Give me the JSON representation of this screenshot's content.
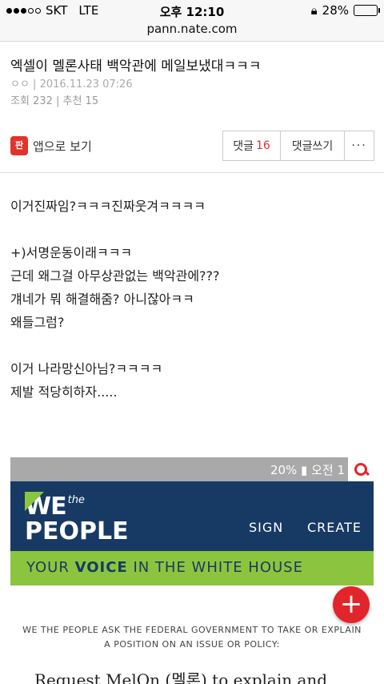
{
  "status_bar": {
    "carrier": "SKT",
    "network": "LTE",
    "time": "오후 12:10",
    "battery": "28%",
    "battery_level": 0.28
  },
  "url": "pann.nate.com",
  "article": {
    "title": "엑셀이 멜론사태 백악관에 메일보냈대ㅋㅋㅋ",
    "author_date": "ㅇㅇ  | 2016.11.23 07:26",
    "stats": "조회 232 | 추천 15"
  },
  "app_bar": {
    "app_icon_text": "판",
    "app_label": "앱으로 보기",
    "comments_label": "댓글",
    "comments_count": "16",
    "write_comment_label": "댓글쓰기",
    "more_label": "···"
  },
  "body_lines": [
    "이거진짜임?ㅋㅋㅋ진짜웃겨ㅋㅋㅋㅋ",
    "",
    "+)서명운동이래ㅋㅋㅋ",
    "근데 왜그걸 아무상관없는 백악관에???",
    "걔네가 뭐 해결해줌? 아니잖아ㅋㅋ",
    "왜들그럼?",
    "",
    "이거 나라망신아님?ㅋㅋㅋㅋ",
    "제발 적당히하자....."
  ],
  "embed": {
    "status_text": "20% ▮ 오전 1",
    "logo_we": "WE",
    "logo_the": "the",
    "logo_people": "PEOPLE",
    "nav_sign": "SIGN",
    "nav_create": "CREATE",
    "banner_pre": "YOUR ",
    "banner_bold": "VOICE",
    "banner_post": " IN THE WHITE HOUSE",
    "desc_line1": "WE THE PEOPLE ASK THE FEDERAL GOVERNMENT TO TAKE OR EXPLAIN",
    "desc_line2": "A POSITION ON AN ISSUE OR POLICY:",
    "petition_title": "Request MelOn (멜론) to explain and"
  },
  "fab_label": "+",
  "colors": {
    "accent_red": "#e0342b",
    "we_the_people_navy": "#173a64",
    "we_the_people_green": "#8bc53f"
  }
}
